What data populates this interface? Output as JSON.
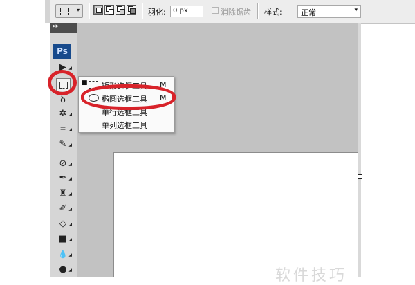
{
  "options_bar": {
    "tool_preset_arrow": "▾",
    "feather_label": "羽化:",
    "feather_value": "0 px",
    "antialias_label": "消除锯齿",
    "style_label": "样式:",
    "style_value": "正常"
  },
  "toolbox": {
    "header_glyph": "▸▸",
    "app_logo": "Ps",
    "tools": [
      {
        "name": "move-tool",
        "icon": "move-icon",
        "glyph": "▶"
      },
      {
        "name": "marquee-tool",
        "icon": "rectangular-marquee-icon",
        "glyph": ""
      },
      {
        "name": "lasso-tool",
        "icon": "lasso-icon",
        "glyph": "ꝺ"
      },
      {
        "name": "magic-wand-tool",
        "icon": "magic-wand-icon",
        "glyph": "✲"
      },
      {
        "name": "crop-tool",
        "icon": "crop-icon",
        "glyph": "⌗"
      },
      {
        "name": "eyedropper-tool",
        "icon": "eyedropper-icon",
        "glyph": "✎"
      },
      {
        "name": "healing-brush-tool",
        "icon": "bandage-icon",
        "glyph": "⊘"
      },
      {
        "name": "brush-tool",
        "icon": "brush-icon",
        "glyph": "✒"
      },
      {
        "name": "clone-stamp-tool",
        "icon": "stamp-icon",
        "glyph": "♜"
      },
      {
        "name": "history-brush-tool",
        "icon": "history-brush-icon",
        "glyph": "✐"
      },
      {
        "name": "eraser-tool",
        "icon": "eraser-icon",
        "glyph": "◇"
      },
      {
        "name": "gradient-tool",
        "icon": "gradient-icon",
        "glyph": "■"
      },
      {
        "name": "blur-tool",
        "icon": "blur-drop-icon",
        "glyph": "💧"
      },
      {
        "name": "dodge-tool",
        "icon": "dodge-icon",
        "glyph": "●"
      }
    ]
  },
  "flyout": {
    "items": [
      {
        "label": "矩形选框工具",
        "shortcut": "M",
        "selected": true,
        "icon": "rectangle-marquee-icon"
      },
      {
        "label": "椭圆选框工具",
        "shortcut": "M",
        "selected": false,
        "icon": "ellipse-marquee-icon"
      },
      {
        "label": "单行选框工具",
        "shortcut": "",
        "selected": false,
        "icon": "single-row-marquee-icon"
      },
      {
        "label": "单列选框工具",
        "shortcut": "",
        "selected": false,
        "icon": "single-column-marquee-icon"
      }
    ],
    "bullet": "■"
  },
  "watermark": "软件技巧",
  "colors": {
    "annotation_red": "#d8232a",
    "workspace_gray": "#c2c2c2",
    "ps_logo_blue": "#174a8c"
  }
}
